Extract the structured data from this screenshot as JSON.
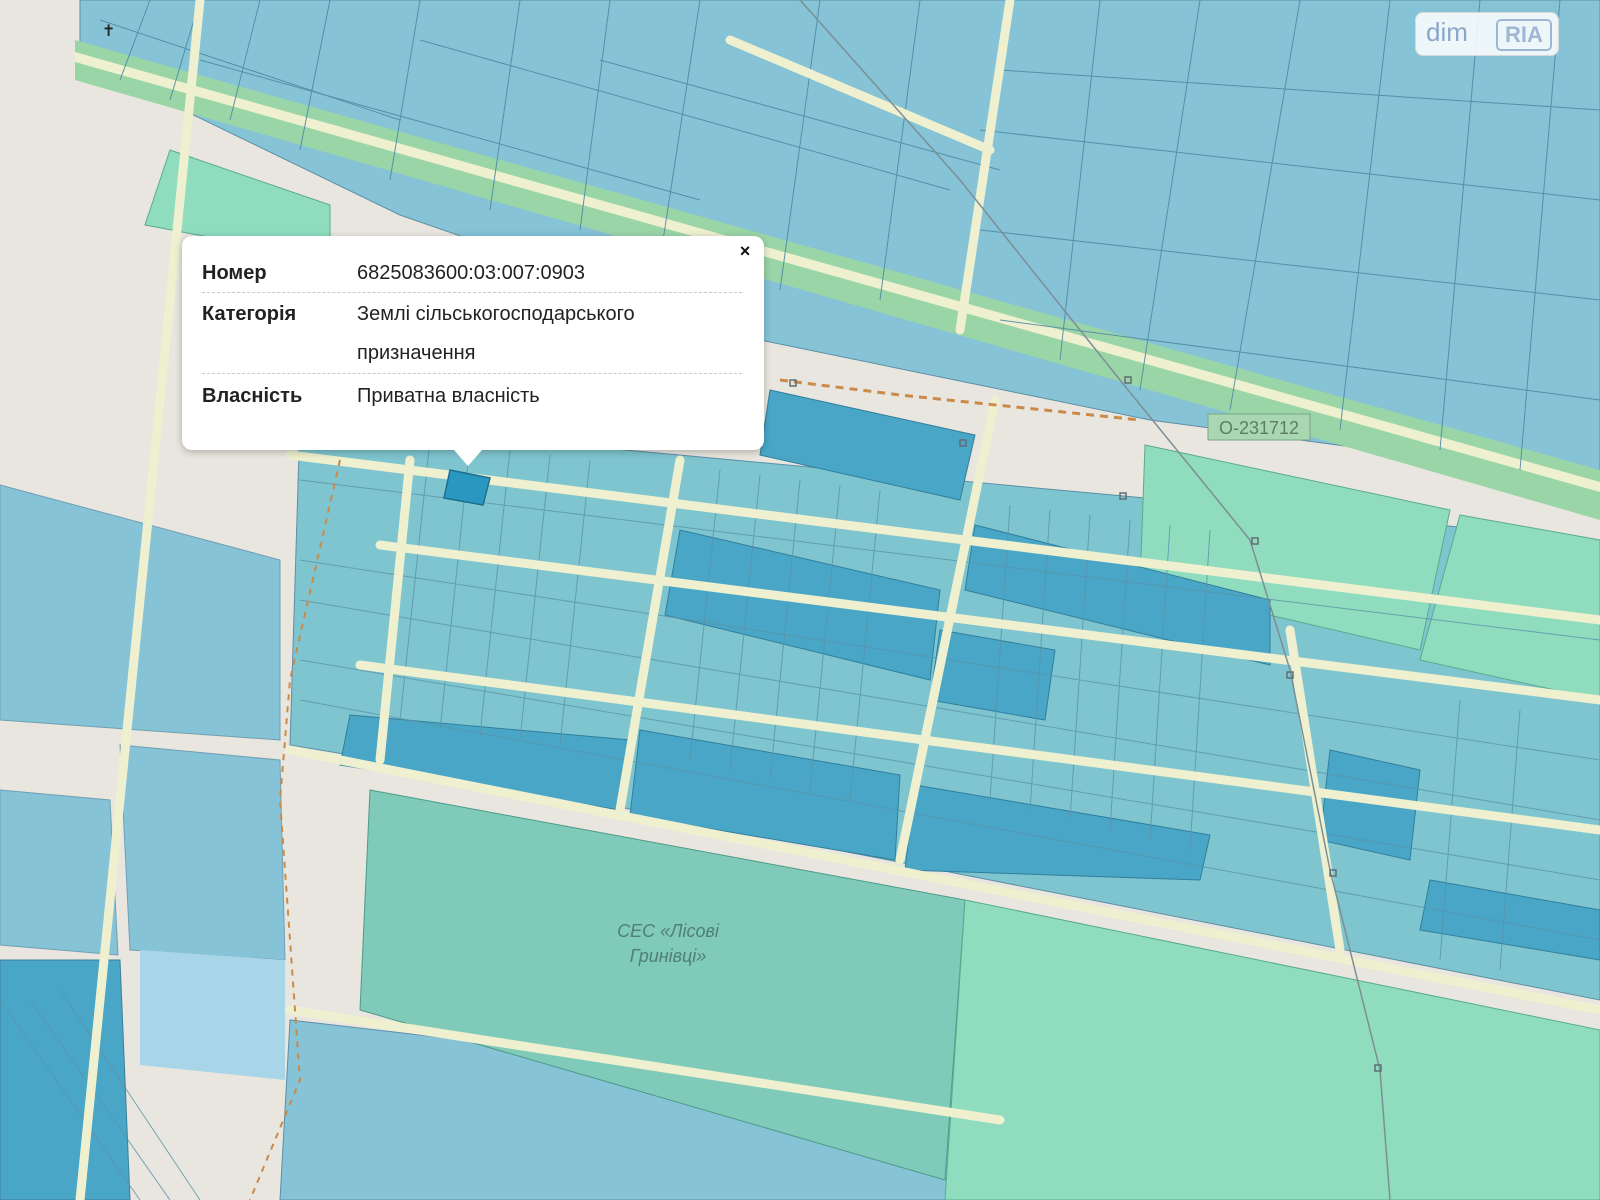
{
  "popup": {
    "close_label": "×",
    "rows": [
      {
        "key": "Номер",
        "value": "6825083600:03:007:0903"
      },
      {
        "key": "Категорія",
        "value_line1": "Землі сільськогосподарського",
        "value_line2": "призначення"
      },
      {
        "key": "Власність",
        "value": "Приватна власність"
      }
    ]
  },
  "map": {
    "place_label_line1": "СЕС «Лісові",
    "place_label_line2": "Гринівці»",
    "road_label": "O-231712",
    "cross_symbol": "✝",
    "colors": {
      "parcel": "#86c3d6",
      "parcel_dark": "#4aa6c6",
      "parcel_mid": "#7fc5cf",
      "green": "#8fdcbf",
      "road": "#eef0cf",
      "highway": "#9ad5a7",
      "base": "#e9e6df",
      "selected": "#2a97c0"
    }
  },
  "logo": {
    "text_a": "dim",
    "text_b": "RIA"
  }
}
